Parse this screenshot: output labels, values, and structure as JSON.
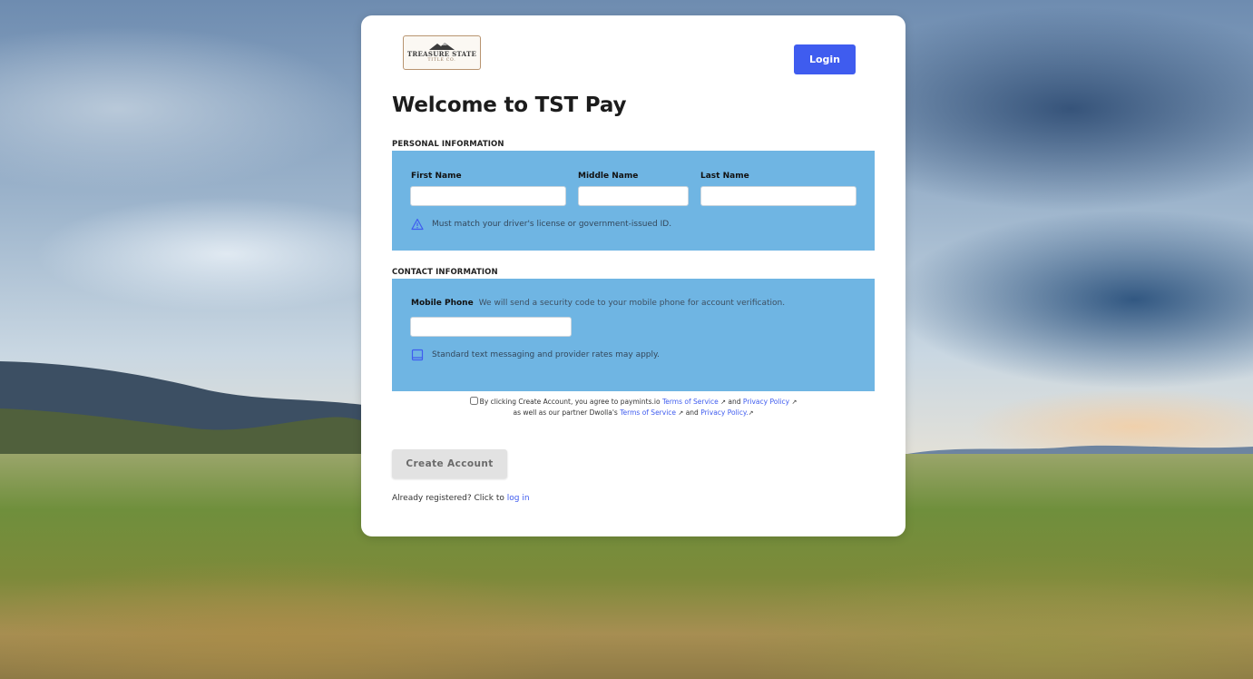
{
  "logo": {
    "top_text": "TREASURE STATE",
    "bottom_text": "TITLE CO."
  },
  "header": {
    "login_label": "Login",
    "title": "Welcome to TST Pay"
  },
  "personal": {
    "heading": "PERSONAL INFORMATION",
    "first_name_label": "First Name",
    "middle_name_label": "Middle Name",
    "last_name_label": "Last Name",
    "first_name_value": "",
    "middle_name_value": "",
    "last_name_value": "",
    "id_note": "Must match your driver's license or government-issued ID.",
    "note_icon": "warning-triangle-icon"
  },
  "contact": {
    "heading": "CONTACT INFORMATION",
    "mobile_label": "Mobile Phone",
    "mobile_desc": "We will send a security code to your mobile phone for account verification.",
    "mobile_value": "",
    "rates_note": "Standard text messaging and provider rates may apply.",
    "note_icon": "mobile-phone-icon"
  },
  "agreement": {
    "checked": false,
    "text_1": "By clicking Create Account, you agree to paymints.io",
    "link_tos_1": "Terms of Service",
    "and_1": "and",
    "link_privacy_1": "Privacy Policy",
    "text_2": "as well as our partner Dwolla's",
    "link_tos_2": "Terms of Service",
    "and_2": "and",
    "link_privacy_2": "Privacy Policy.",
    "external_icon": "external-link-icon"
  },
  "footer": {
    "create_label": "Create Account",
    "already_text": "Already registered? Click to",
    "login_link": "log in"
  },
  "colors": {
    "accent": "#3f5cef",
    "panel": "#6fb5e3",
    "button_disabled": "#e2e2e2"
  }
}
